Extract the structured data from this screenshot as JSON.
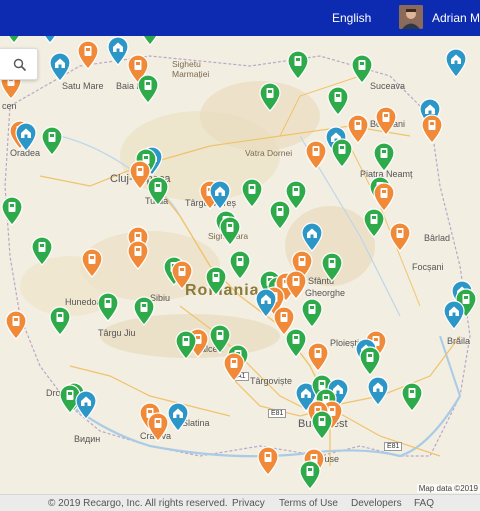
{
  "header": {
    "language": "English",
    "username": "Adrian Mit"
  },
  "map": {
    "country_label": "Romania",
    "labels": {
      "satu_mare": "Satu Mare",
      "baia_mare": "Baia Mare",
      "sighetu": "Sighetu",
      "marmatiei": "Marmației",
      "suceava": "Suceava",
      "botosani": "Botoșani",
      "vatra_dornei": "Vatra Dornei",
      "piatra_neamt": "Piatra Neamț",
      "oradea": "Oradea",
      "cluj_napoca": "Cluj-Napoca",
      "turda": "Turda",
      "targu_mures": "Târgu Mureș",
      "sighisoara": "Sighișoara",
      "barlad": "Bârlad",
      "hunedoara": "Hunedoara",
      "sibiu": "Sibiu",
      "sfantu": "Sfântu",
      "gheorghe": "Gheorghe",
      "focsani": "Focșani",
      "targu_jiu": "Târgu Jiu",
      "valcea": "Vâlcea",
      "ploiesti": "Ploiești",
      "braila": "Brăila",
      "targoviste": "Târgoviște",
      "drobeta": "Drob",
      "craiova": "Craiova",
      "slatina": "Slatina",
      "bucharest": "Bucharest",
      "ruse": "Ruse",
      "vidin": "Видин",
      "cen": "cen",
      "a1": "A1",
      "e81": "E81",
      "e81b": "E81"
    },
    "map_data": "Map data ©2019"
  },
  "pins": [
    {
      "type": "charger",
      "color": "#2eaa4a"
    },
    {
      "type": "charger",
      "color": "#2eaa4a"
    },
    {
      "type": "home",
      "color": "#2c96c7"
    },
    {
      "type": "charger",
      "color": "#f08a38"
    }
  ],
  "colors": {
    "header": "#0c2bb0",
    "green_pin": "#2eaa4a",
    "orange_pin": "#f08a38",
    "blue_pin": "#2c96c7"
  },
  "footer": {
    "copyright": "© 2019 Recargo, Inc. All rights reserved.",
    "privacy": "Privacy",
    "terms": "Terms of Use",
    "developers": "Developers",
    "faq": "FAQ"
  },
  "search": {
    "icon": "search-icon"
  }
}
